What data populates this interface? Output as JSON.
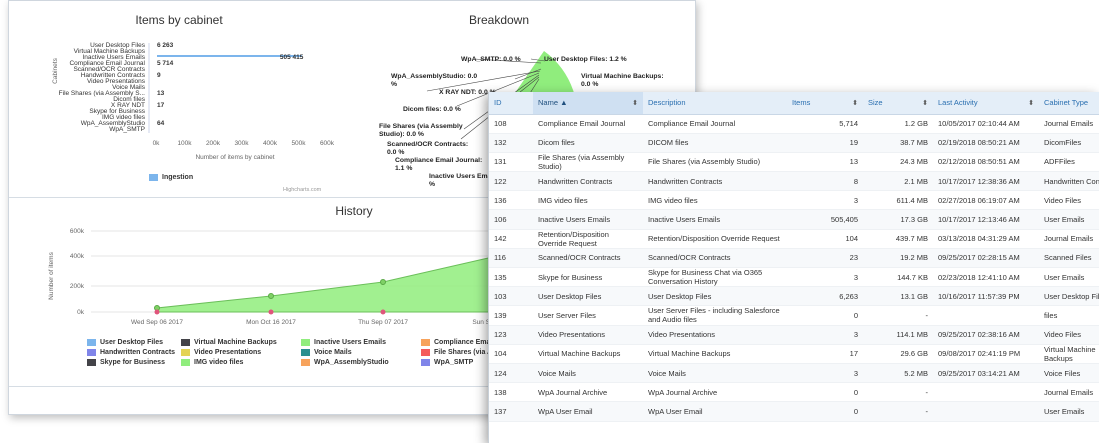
{
  "cabinet_chart": {
    "title": "Items by cabinet",
    "y_axis_label": "Cabinets",
    "x_axis_label": "Number of items by cabinet",
    "x_ticks": [
      "0k",
      "100k",
      "200k",
      "300k",
      "400k",
      "500k",
      "600k"
    ],
    "legend": "Ingestion",
    "credit": "Highcharts.com",
    "categories": [
      "User Desktop Files",
      "Virtual Machine Backups",
      "Inactive Users Emails",
      "Compliance Email Journal",
      "Scanned/OCR Contracts",
      "Handwritten Contracts",
      "Video Presentations",
      "Voice Mails",
      "File Shares (via Assembly S...",
      "Dicom files",
      "X RAY NDT",
      "Skype for Business",
      "IMG video files",
      "WpA_AssemblyStudio",
      "WpA_SMTP"
    ],
    "value_labels": [
      "6 263",
      "",
      "505 415",
      "5 714",
      "",
      "9",
      "",
      "",
      "13",
      "",
      "17",
      "",
      "",
      "64",
      ""
    ]
  },
  "breakdown_chart": {
    "title": "Breakdown",
    "labels": [
      "WpA_SMTP: 0.0 %",
      "User Desktop Files: 1.2 %",
      "Virtual Machine Backups:",
      "0.0 %",
      "WpA_AssemblyStudio: 0.0",
      "%",
      "X RAY NDT: 0.0 %",
      "Dicom files: 0.0 %",
      "File Shares (via Assembly",
      "Studio): 0.0 %",
      "Scanned/OCR Contracts:",
      "0.0 %",
      "Compliance Email Journal:",
      "1.1 %",
      "Inactive Users Emails",
      "%"
    ]
  },
  "history_chart": {
    "title": "History",
    "y_axis_label": "Number of items",
    "y_ticks": [
      "600k",
      "400k",
      "200k",
      "0k"
    ],
    "x_ticks": [
      "Wed Sep 06 2017",
      "Mon Oct 16 2017",
      "Thu Sep 07 2017",
      "Sun Se"
    ],
    "legend": [
      {
        "label": "User Desktop Files",
        "color": "#7cb5ec"
      },
      {
        "label": "Virtual Machine Backups",
        "color": "#434348"
      },
      {
        "label": "Inactive Users Emails",
        "color": "#90ed7d"
      },
      {
        "label": "Compliance Email Jou",
        "color": "#f7a35c"
      },
      {
        "label": "Handwritten Contracts",
        "color": "#8085e9"
      },
      {
        "label": "Video Presentations",
        "color": "#e4d354"
      },
      {
        "label": "Voice Mails",
        "color": "#2b908f"
      },
      {
        "label": "File Shares (via Assembly Studio",
        "color": "#f45b5b"
      },
      {
        "label": "Skype for Business",
        "color": "#434348"
      },
      {
        "label": "IMG video files",
        "color": "#90ed7d"
      },
      {
        "label": "WpA_AssemblyStudio",
        "color": "#f7a35c"
      },
      {
        "label": "WpA_SMTP",
        "color": "#8085e9"
      }
    ]
  },
  "table": {
    "headers": {
      "id": "ID",
      "name": "Name ▲",
      "description": "Description",
      "items": "Items",
      "size": "Size",
      "last_activity": "Last Activity",
      "cabinet_type": "Cabinet Type"
    },
    "rows": [
      {
        "id": "108",
        "name": "Compliance Email Journal",
        "description": "Compliance Email Journal",
        "items": "5,714",
        "size": "1.2 GB",
        "last_activity": "10/05/2017 02:10:44 AM",
        "cabinet_type": "Journal Emails"
      },
      {
        "id": "132",
        "name": "Dicom files",
        "description": "DICOM files",
        "items": "19",
        "size": "38.7 MB",
        "last_activity": "02/19/2018 08:50:21 AM",
        "cabinet_type": "DicomFiles"
      },
      {
        "id": "131",
        "name": "File Shares (via Assembly Studio)",
        "description": "File Shares (via Assembly Studio)",
        "items": "13",
        "size": "24.3 MB",
        "last_activity": "02/12/2018 08:50:51 AM",
        "cabinet_type": "ADFFiles"
      },
      {
        "id": "122",
        "name": "Handwritten Contracts",
        "description": "Handwritten Contracts",
        "items": "8",
        "size": "2.1 MB",
        "last_activity": "10/17/2017 12:38:36 AM",
        "cabinet_type": "Handwritten Contracts"
      },
      {
        "id": "136",
        "name": "IMG video files",
        "description": "IMG video files",
        "items": "3",
        "size": "611.4 MB",
        "last_activity": "02/27/2018 06:19:07 AM",
        "cabinet_type": "Video Files"
      },
      {
        "id": "106",
        "name": "Inactive Users Emails",
        "description": "Inactive Users Emails",
        "items": "505,405",
        "size": "17.3 GB",
        "last_activity": "10/17/2017 12:13:46 AM",
        "cabinet_type": "User Emails"
      },
      {
        "id": "142",
        "name": "Retention/Disposition Override Request",
        "description": "Retention/Disposition Override Request",
        "items": "104",
        "size": "439.7 MB",
        "last_activity": "03/13/2018 04:31:29 AM",
        "cabinet_type": "Journal Emails"
      },
      {
        "id": "116",
        "name": "Scanned/OCR Contracts",
        "description": "Scanned/OCR Contracts",
        "items": "23",
        "size": "19.2 MB",
        "last_activity": "09/25/2017 02:28:15 AM",
        "cabinet_type": "Scanned Files"
      },
      {
        "id": "135",
        "name": "Skype for Business",
        "description": "Skype for Business Chat via O365 Conversation History",
        "items": "3",
        "size": "144.7 KB",
        "last_activity": "02/23/2018 12:41:10 AM",
        "cabinet_type": "User Emails"
      },
      {
        "id": "103",
        "name": "User Desktop Files",
        "description": "User Desktop Files",
        "items": "6,263",
        "size": "13.1 GB",
        "last_activity": "10/16/2017 11:57:39 PM",
        "cabinet_type": "User Desktop Files"
      },
      {
        "id": "139",
        "name": "User Server Files",
        "description": "User Server Files - including Salesforce and Audio files",
        "items": "0",
        "size": "-",
        "last_activity": "",
        "cabinet_type": "files"
      },
      {
        "id": "123",
        "name": "Video Presentations",
        "description": "Video Presentations",
        "items": "3",
        "size": "114.1 MB",
        "last_activity": "09/25/2017 02:38:16 AM",
        "cabinet_type": "Video Files"
      },
      {
        "id": "104",
        "name": "Virtual Machine Backups",
        "description": "Virtual Machine Backups",
        "items": "17",
        "size": "29.6 GB",
        "last_activity": "09/08/2017 02:41:19 PM",
        "cabinet_type": "Virtual Machine Backups"
      },
      {
        "id": "124",
        "name": "Voice Mails",
        "description": "Voice Mails",
        "items": "3",
        "size": "5.2 MB",
        "last_activity": "09/25/2017 03:14:21 AM",
        "cabinet_type": "Voice Files"
      },
      {
        "id": "138",
        "name": "WpA Journal Archive",
        "description": "WpA Journal Archive",
        "items": "0",
        "size": "-",
        "last_activity": "",
        "cabinet_type": "Journal Emails"
      },
      {
        "id": "137",
        "name": "WpA User Email",
        "description": "WpA User Email",
        "items": "0",
        "size": "-",
        "last_activity": "",
        "cabinet_type": "User Emails"
      }
    ]
  }
}
